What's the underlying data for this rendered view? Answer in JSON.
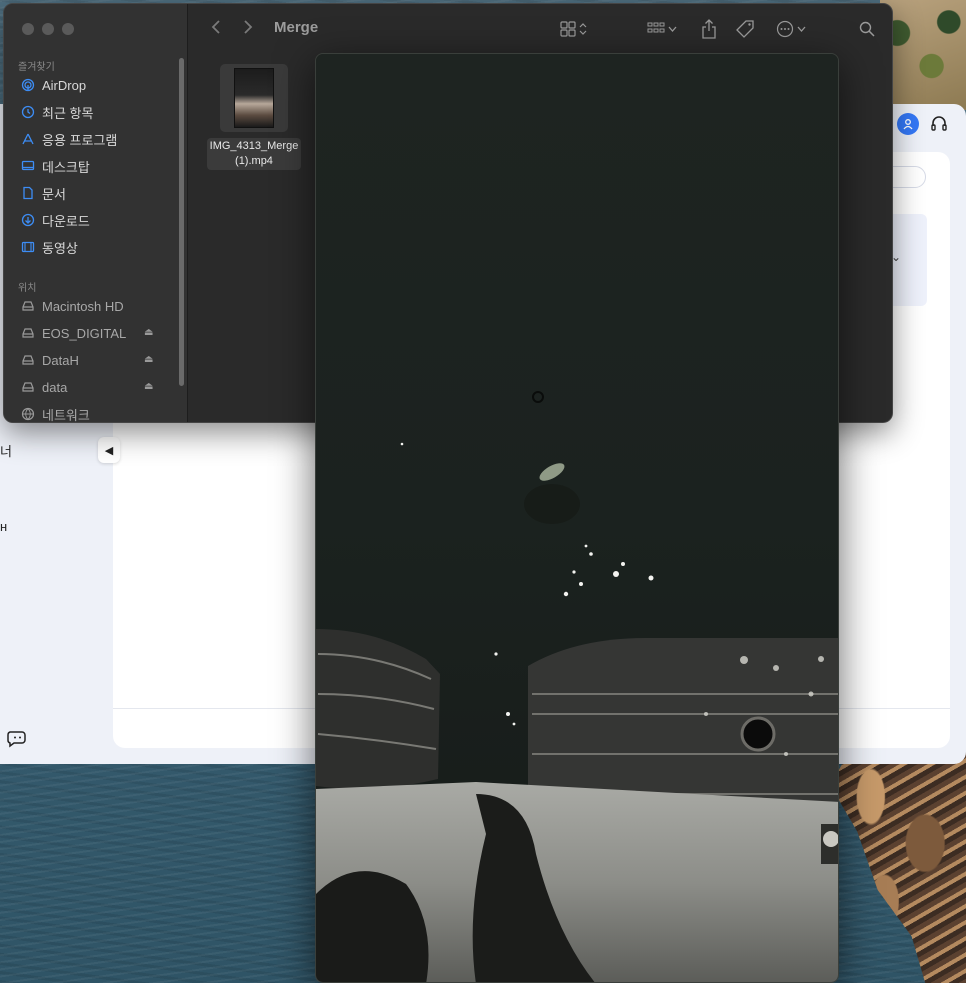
{
  "finder": {
    "title": "Merge",
    "sections": {
      "favorites": "즐겨찾기",
      "locations": "위치"
    },
    "favorites": [
      {
        "label": "AirDrop",
        "icon": "airdrop-icon"
      },
      {
        "label": "최근 항목",
        "icon": "clock-icon"
      },
      {
        "label": "응용 프로그램",
        "icon": "applications-icon"
      },
      {
        "label": "데스크탑",
        "icon": "desktop-icon"
      },
      {
        "label": "문서",
        "icon": "document-icon"
      },
      {
        "label": "다운로드",
        "icon": "download-icon"
      },
      {
        "label": "동영상",
        "icon": "film-icon"
      }
    ],
    "locations": [
      {
        "label": "Macintosh HD",
        "icon": "disk-icon"
      },
      {
        "label": "EOS_DIGITAL",
        "icon": "disk-icon",
        "eject": true
      },
      {
        "label": "DataH",
        "icon": "disk-icon",
        "eject": true
      },
      {
        "label": "data",
        "icon": "disk-icon",
        "eject": true
      },
      {
        "label": "네트워크",
        "icon": "network-icon"
      }
    ],
    "file": {
      "name_line1": "IMG_4313_Merge",
      "name_line2": "(1).mp4"
    }
  },
  "background_app": {
    "side_text_1": "너",
    "side_text_2": "н"
  },
  "colors": {
    "accent_blue": "#3478f6",
    "finder_bg": "#2a2a2a",
    "sidebar_bg": "#323232",
    "sidebar_icon": "#3d8df5"
  }
}
